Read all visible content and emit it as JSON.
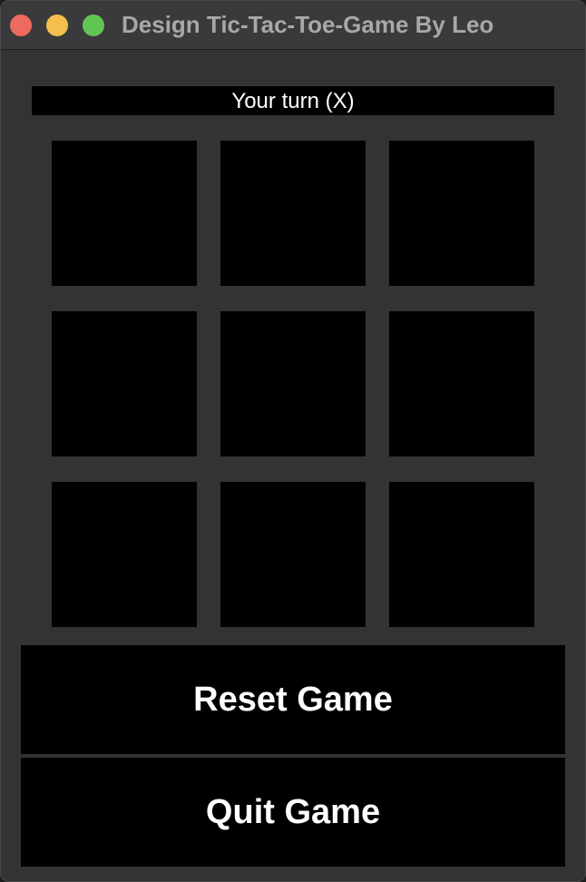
{
  "window": {
    "title": "Design Tic-Tac-Toe-Game By Leo"
  },
  "status": {
    "text": "Your turn (X)"
  },
  "board": {
    "cells": [
      "",
      "",
      "",
      "",
      "",
      "",
      "",
      "",
      ""
    ]
  },
  "buttons": {
    "reset_label": "Reset Game",
    "quit_label": "Quit Game"
  },
  "colors": {
    "window_background": "#333333",
    "cell_background": "#000000",
    "text": "#ffffff",
    "close": "#ed6a5e",
    "minimize": "#f5bf4f",
    "zoom": "#61c554"
  }
}
